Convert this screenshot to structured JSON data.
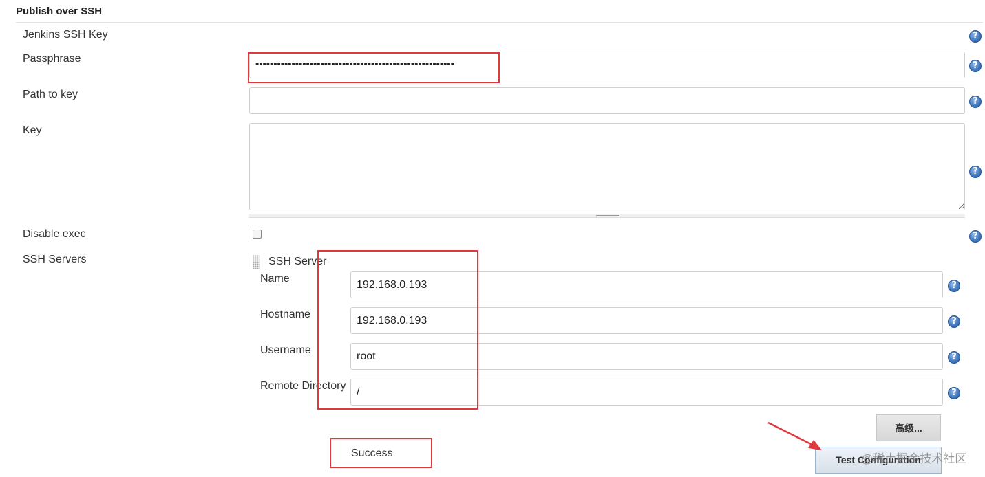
{
  "section": {
    "title": "Publish over SSH"
  },
  "fields": {
    "jenkins_ssh_key_label": "Jenkins SSH Key",
    "passphrase_label": "Passphrase",
    "passphrase_value": "•••••••••••••••••••••••••••••••••••••••••••••••••••••••",
    "path_to_key_label": "Path to key",
    "path_to_key_value": "",
    "key_label": "Key",
    "key_value": "",
    "disable_exec_label": "Disable exec",
    "ssh_servers_label": "SSH Servers"
  },
  "ssh_server": {
    "header": "SSH Server",
    "name_label": "Name",
    "name_value": "192.168.0.193",
    "hostname_label": "Hostname",
    "hostname_value": "192.168.0.193",
    "username_label": "Username",
    "username_value": "root",
    "remote_dir_label": "Remote Directory",
    "remote_dir_value": "/"
  },
  "buttons": {
    "advanced": "高级...",
    "test_configuration": "Test Configuration"
  },
  "status": {
    "result": "Success"
  },
  "help_glyph": "?",
  "watermark": "@稀土掘金技术社区",
  "colors": {
    "annotation_red": "#e0383c",
    "help_blue": "#3f78bf"
  }
}
